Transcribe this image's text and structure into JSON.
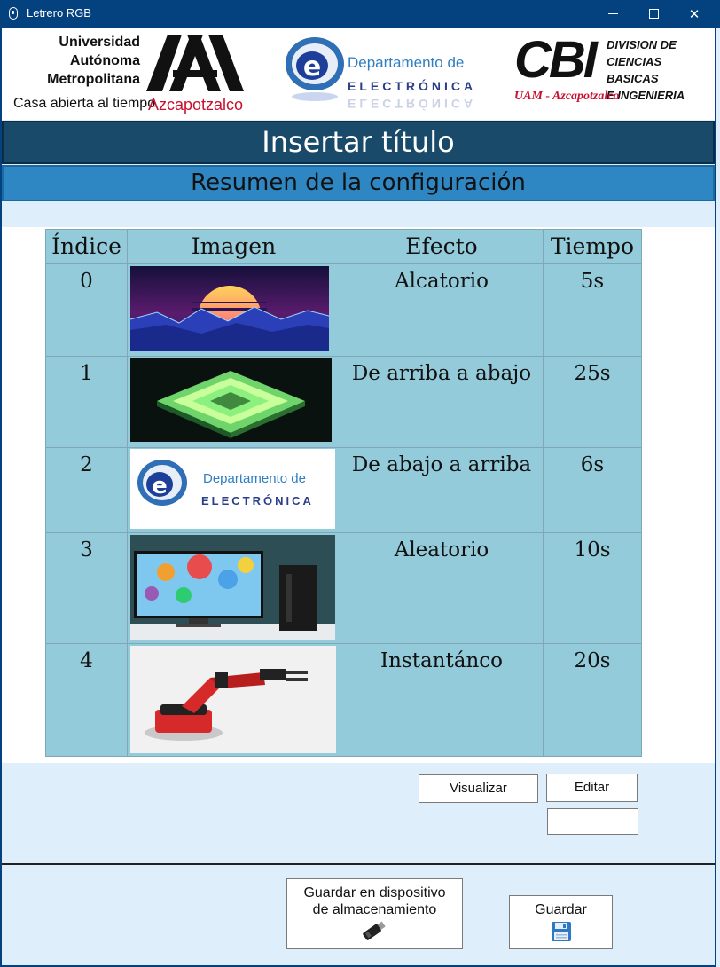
{
  "window": {
    "title": "Letrero RGB"
  },
  "logos": {
    "uam_lines": [
      "Universidad",
      "Autónoma",
      "Metropolitana"
    ],
    "uam_tagline": "Casa abierta al tiempo",
    "uam_campus": "Azcapotzalco",
    "dept_line1": "Departamento de",
    "dept_line2": "ELECTRÓNICA",
    "cbi_mark": "CBI",
    "cbi_lines": [
      "DIVISION DE",
      "CIENCIAS BASICAS",
      "E INGENIERIA"
    ],
    "cbi_sub": "UAM - Azcapotzalco"
  },
  "header": {
    "title": "Insertar título",
    "subtitle": "Resumen de la configuración"
  },
  "table": {
    "headers": [
      "Índice",
      "Imagen",
      "Efecto",
      "Tiempo"
    ],
    "rows": [
      {
        "index": "0",
        "image": "synthwave-sunset-image",
        "effect": "Alcatorio",
        "time": "5s"
      },
      {
        "index": "1",
        "image": "glowing-chip-image",
        "effect": "De arriba a abajo",
        "time": "25s"
      },
      {
        "index": "2",
        "image": "departamento-electronica-logo-image",
        "effect": "De abajo a arriba",
        "time": "6s"
      },
      {
        "index": "3",
        "image": "monitor-balloons-image",
        "effect": "Aleatorio",
        "time": "10s"
      },
      {
        "index": "4",
        "image": "robotic-arm-image",
        "effect": "Instantánco",
        "time": "20s"
      }
    ],
    "thumb_dept_line1": "Departamento de",
    "thumb_dept_line2": "ELECTRÓNICA"
  },
  "actions": {
    "visualize": "Visualizar",
    "edit": "Editar",
    "edit_value": "",
    "save_device_line1": "Guardar en dispositivo",
    "save_device_line2": "de almacenamiento",
    "save": "Guardar"
  },
  "icons": {
    "app": "candle-icon",
    "usb": "usb-drive-icon",
    "save": "floppy-disk-icon"
  },
  "colors": {
    "titlebar": "#04417f",
    "header_title_bg": "#1a4a6a",
    "header_sub_bg": "#2e87c3",
    "table_bg": "#93cbda",
    "body_bg": "#dfeefb"
  }
}
